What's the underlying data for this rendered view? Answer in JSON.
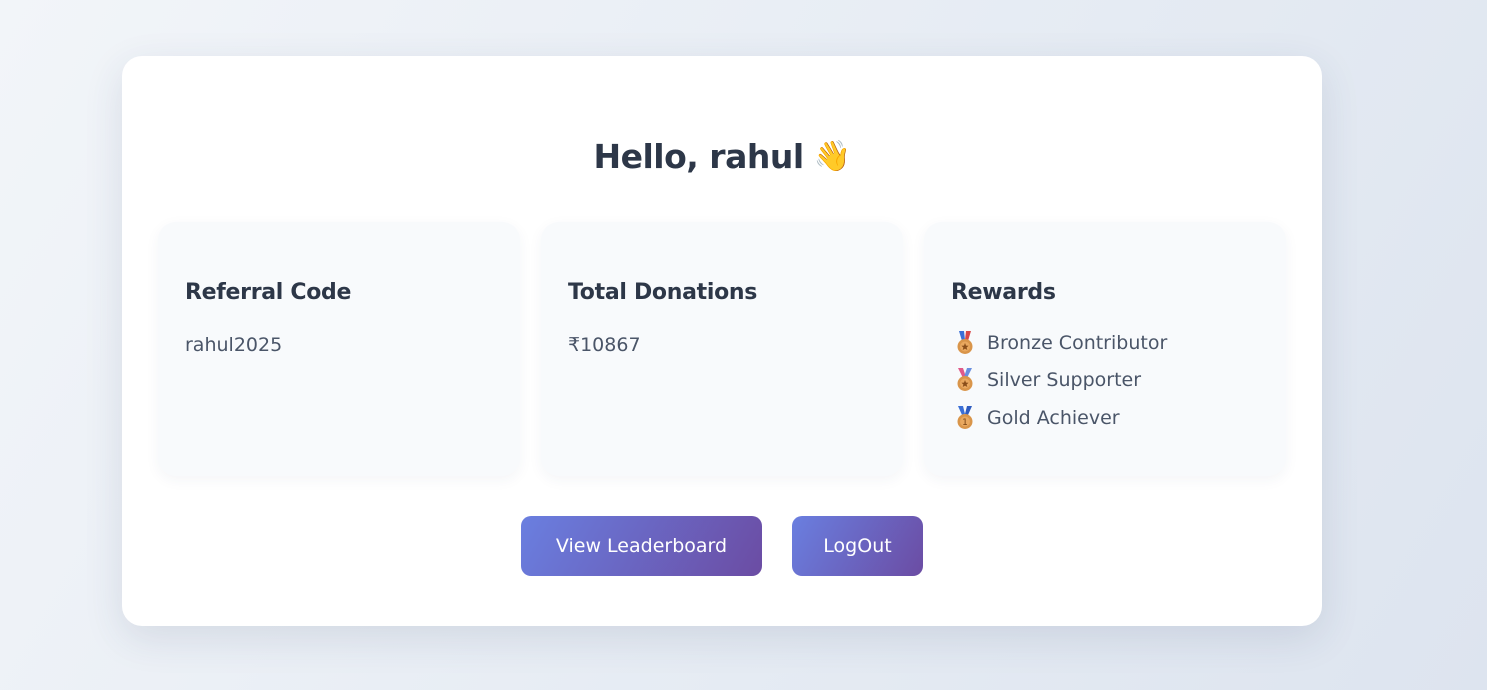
{
  "greeting": {
    "text": "Hello, rahul",
    "emoji": "👋"
  },
  "tiles": {
    "referral": {
      "title": "Referral Code",
      "value": "rahul2025"
    },
    "donations": {
      "title": "Total Donations",
      "value": "₹10867"
    },
    "rewards": {
      "title": "Rewards",
      "items": [
        {
          "label": "Bronze Contributor",
          "icon": "bronze-medal-icon"
        },
        {
          "label": "Silver Supporter",
          "icon": "silver-medal-icon"
        },
        {
          "label": "Gold Achiever",
          "icon": "gold-medal-icon"
        }
      ]
    }
  },
  "buttons": {
    "leaderboard_label": "View Leaderboard",
    "logout_label": "LogOut"
  },
  "colors": {
    "button_gradient_start": "#6a7fe0",
    "button_gradient_end": "#6b4ca3",
    "heading": "#2d3748",
    "body_text": "#4a5568"
  }
}
